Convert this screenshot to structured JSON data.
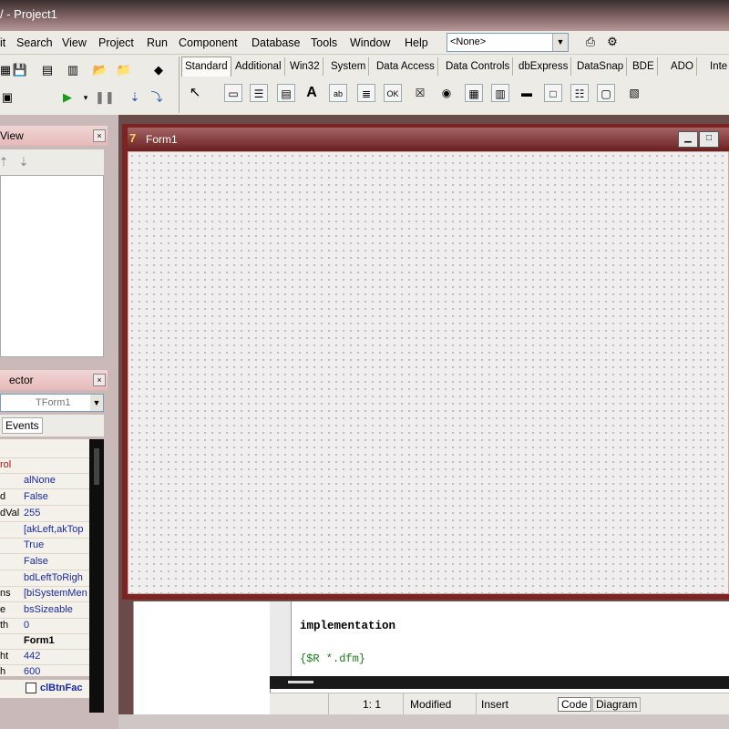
{
  "window": {
    "title": "/ - Project1"
  },
  "menu": [
    "it",
    "Search",
    "View",
    "Project",
    "Run",
    "Component",
    "Database",
    "Tools",
    "Window",
    "Help"
  ],
  "desktop_combo": {
    "value": "<None>"
  },
  "palette_tabs": [
    "Standard",
    "Additional",
    "Win32",
    "System",
    "Data Access",
    "Data Controls",
    "dbExpress",
    "DataSnap",
    "BDE",
    "ADO",
    "Inte"
  ],
  "tree_view": {
    "title": "View"
  },
  "object_inspector": {
    "title": "ector",
    "selected": "TForm1",
    "tab": "Events",
    "highlight_prop": "rol",
    "rows": [
      {
        "name": "",
        "value": "alNone"
      },
      {
        "name": "d",
        "value": "False"
      },
      {
        "name": "dVal",
        "value": "255"
      },
      {
        "name": "",
        "value": "[akLeft,akTop"
      },
      {
        "name": "",
        "value": "True"
      },
      {
        "name": "",
        "value": "False"
      },
      {
        "name": "",
        "value": "bdLeftToRigh"
      },
      {
        "name": "ns",
        "value": "[biSystemMen"
      },
      {
        "name": "e",
        "value": "bsSizeable"
      },
      {
        "name": "th",
        "value": "0"
      },
      {
        "name": "",
        "value": "Form1"
      },
      {
        "name": "ht",
        "value": "442"
      },
      {
        "name": "h",
        "value": "600"
      },
      {
        "name": "",
        "value": "clBtnFac"
      }
    ]
  },
  "form": {
    "title": "Form1"
  },
  "editor": {
    "line1": "implementation",
    "line2": "{$R *.dfm}"
  },
  "status": {
    "position": "1: 1",
    "modified": "Modified",
    "mode": "Insert",
    "tab_code": "Code",
    "tab_diagram": "Diagram"
  },
  "colors": {
    "form_frame": "#7b2424",
    "panel_head": "#e7b9b9",
    "value_text": "#1a2aa0"
  }
}
